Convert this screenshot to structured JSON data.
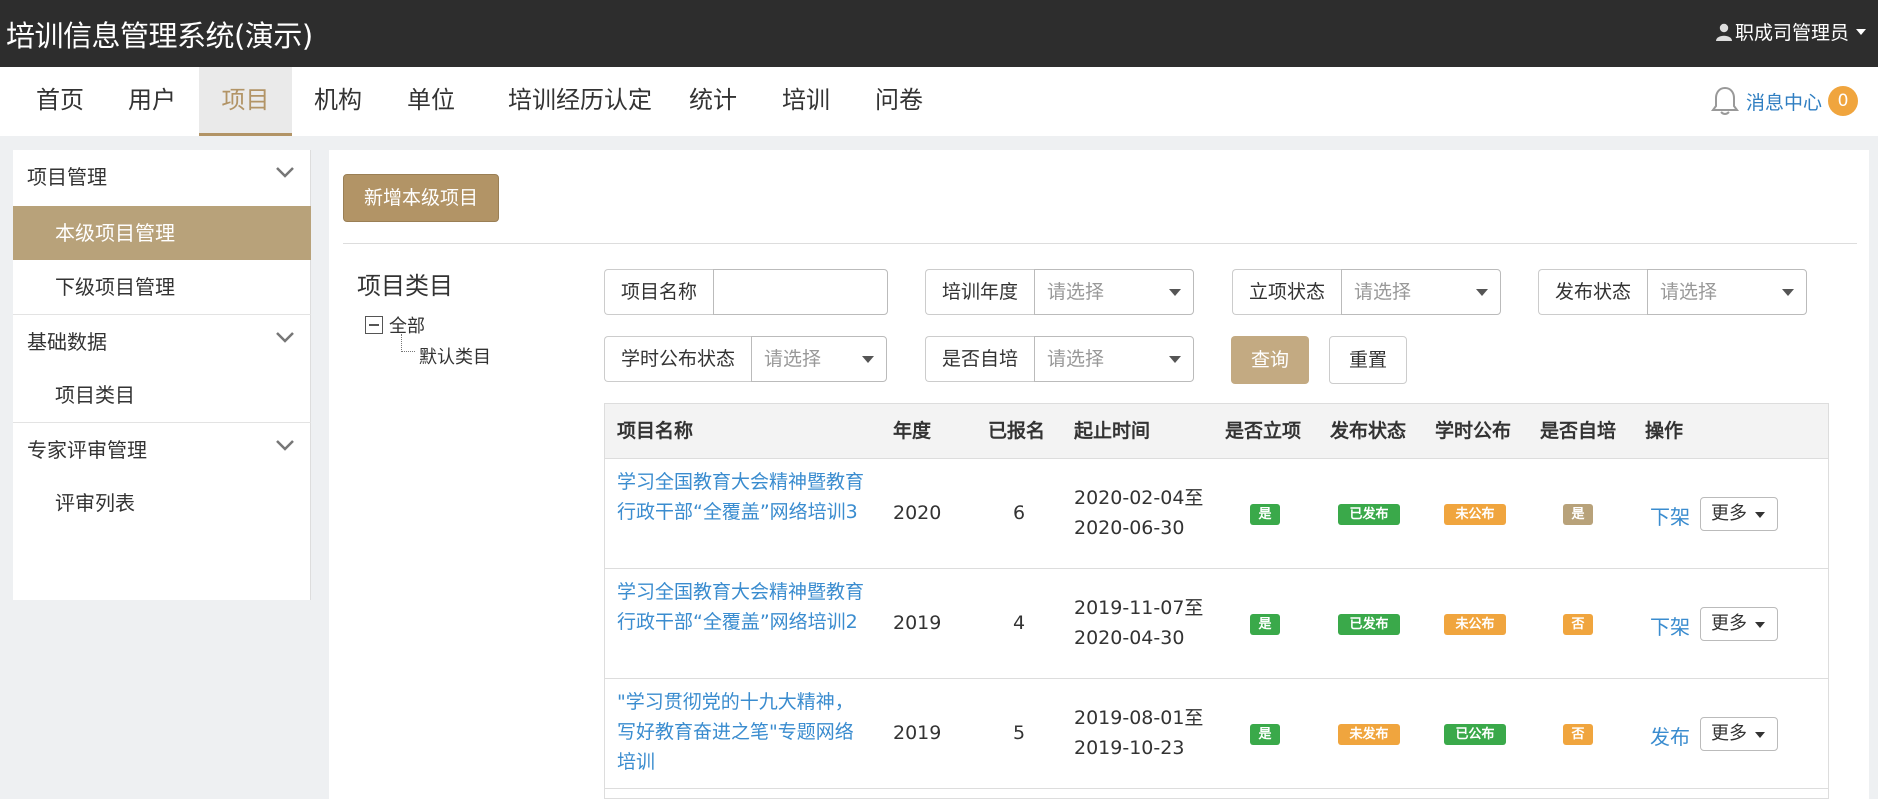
{
  "app": {
    "title": "培训信息管理系统(演示)",
    "user": "职成司管理员"
  },
  "nav": {
    "items": [
      "首页",
      "用户",
      "项目",
      "机构",
      "单位",
      "培训经历认定",
      "统计",
      "培训",
      "问卷"
    ],
    "message_center": "消息中心",
    "message_count": "0"
  },
  "sidebar": {
    "groups": [
      {
        "label": "项目管理",
        "items": [
          "本级项目管理",
          "下级项目管理"
        ]
      },
      {
        "label": "基础数据",
        "items": [
          "项目类目"
        ]
      },
      {
        "label": "专家评审管理",
        "items": [
          "评审列表"
        ]
      }
    ],
    "active_item": "本级项目管理"
  },
  "main": {
    "add_button": "新增本级项目",
    "category": {
      "title": "项目类目",
      "root": "全部",
      "child": "默认类目"
    },
    "filters": {
      "project_name": {
        "label": "项目名称",
        "value": ""
      },
      "year": {
        "label": "培训年度",
        "placeholder": "请选择"
      },
      "approval": {
        "label": "立项状态",
        "placeholder": "请选择"
      },
      "publish": {
        "label": "发布状态",
        "placeholder": "请选择"
      },
      "hours_publish": {
        "label": "学时公布状态",
        "placeholder": "请选择"
      },
      "self_train": {
        "label": "是否自培",
        "placeholder": "请选择"
      }
    },
    "query_button": "查询",
    "reset_button": "重置",
    "table": {
      "headers": [
        "项目名称",
        "年度",
        "已报名",
        "起止时间",
        "是否立项",
        "发布状态",
        "学时公布",
        "是否自培",
        "操作"
      ],
      "rows": [
        {
          "name": "学习全国教育大会精神暨教育行政干部“全覆盖”网络培训3",
          "year": "2020",
          "enrolled": "6",
          "start": "2020-02-04至",
          "end": "2020-06-30",
          "approved": "是",
          "publish": "已发布",
          "hours": "未公布",
          "self": "是",
          "action": "下架",
          "more": "更多"
        },
        {
          "name": "学习全国教育大会精神暨教育行政干部“全覆盖”网络培训2",
          "year": "2019",
          "enrolled": "4",
          "start": "2019-11-07至",
          "end": "2020-04-30",
          "approved": "是",
          "publish": "已发布",
          "hours": "未公布",
          "self": "否",
          "action": "下架",
          "more": "更多"
        },
        {
          "name": "\"学习贯彻党的十九大精神，写好教育奋进之笔\"专题网络培训",
          "year": "2019",
          "enrolled": "5",
          "start": "2019-08-01至",
          "end": "2019-10-23",
          "approved": "是",
          "publish": "未发布",
          "hours": "已公布",
          "self": "否",
          "action": "发布",
          "more": "更多"
        }
      ]
    }
  },
  "colors": {
    "topbar": "#2d2d2d",
    "accent": "#b29466",
    "link": "#3a8ccf",
    "green": "#3aa94a",
    "orange": "#f0a53e"
  }
}
